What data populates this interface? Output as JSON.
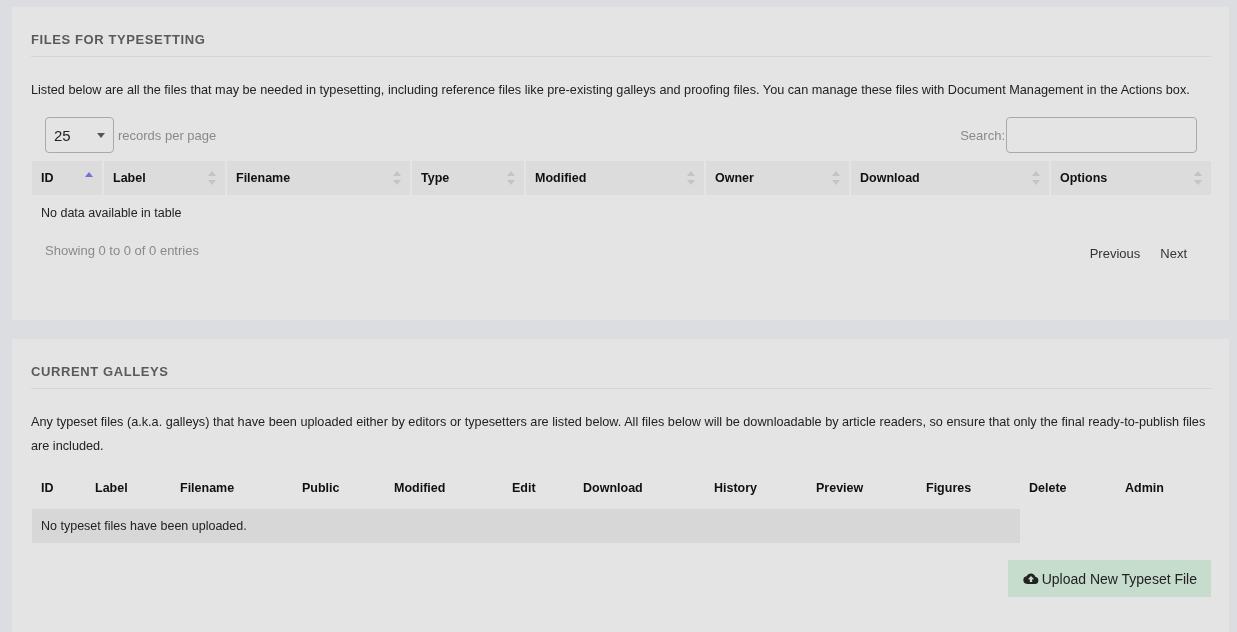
{
  "files_for_typesetting": {
    "title": "FILES FOR TYPESETTING",
    "description": "Listed below are all the files that may be needed in typesetting, including reference files like pre-existing galleys and proofing files. You can manage these files with Document Management in the Actions box.",
    "records_per_page": {
      "value": "25",
      "label": "records per page"
    },
    "search": {
      "label": "Search:"
    },
    "table": {
      "columns": [
        {
          "label": "ID",
          "sorted": true
        },
        {
          "label": "Label",
          "sorted": false
        },
        {
          "label": "Filename",
          "sorted": false
        },
        {
          "label": "Type",
          "sorted": false
        },
        {
          "label": "Modified",
          "sorted": false
        },
        {
          "label": "Owner",
          "sorted": false
        },
        {
          "label": "Download",
          "sorted": false
        },
        {
          "label": "Options",
          "sorted": false
        }
      ],
      "empty_message": "No data available in table"
    },
    "info": "Showing 0 to 0 of 0 entries",
    "pagination": [
      "Previous",
      "Next"
    ]
  },
  "current_galleys": {
    "title": "CURRENT GALLEYS",
    "description": "Any typeset files (a.k.a. galleys) that have been uploaded either by editors or typesetters are listed below. All files below will be downloadable by article readers, so ensure that only the final ready-to-publish files are included.",
    "table": {
      "columns": [
        "ID",
        "Label",
        "Filename",
        "Public",
        "Modified",
        "Edit",
        "Download",
        "History",
        "Preview",
        "Figures",
        "Delete",
        "Admin"
      ],
      "empty_message": "No typeset files have been uploaded."
    },
    "upload_button": {
      "label": "Upload New Typeset File"
    }
  }
}
